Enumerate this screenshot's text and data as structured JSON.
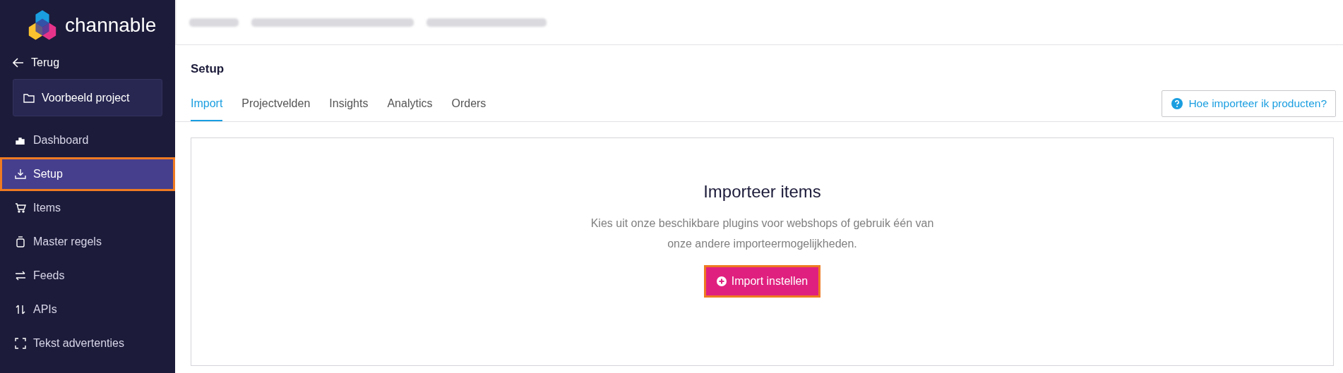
{
  "sidebar": {
    "logo_text": "channable",
    "back_label": "Terug",
    "project": "Voorbeeld project",
    "items": [
      {
        "label": "Dashboard",
        "kind": "chart",
        "selected": false,
        "highlighted": false
      },
      {
        "label": "Setup",
        "kind": "download",
        "selected": true,
        "highlighted": true
      },
      {
        "label": "Items",
        "kind": "cart",
        "selected": false,
        "highlighted": false
      },
      {
        "label": "Master regels",
        "kind": "jar",
        "selected": false,
        "highlighted": false
      },
      {
        "label": "Feeds",
        "kind": "arrows",
        "selected": false,
        "highlighted": false
      },
      {
        "label": "APIs",
        "kind": "updown",
        "selected": false,
        "highlighted": false
      },
      {
        "label": "Tekst advertenties",
        "kind": "frame",
        "selected": false,
        "highlighted": false
      }
    ]
  },
  "page": {
    "title": "Setup",
    "tabs": [
      {
        "label": "Import",
        "selected": true
      },
      {
        "label": "Projectvelden",
        "selected": false
      },
      {
        "label": "Insights",
        "selected": false
      },
      {
        "label": "Analytics",
        "selected": false
      },
      {
        "label": "Orders",
        "selected": false
      }
    ],
    "help_button": "Hoe importeer ik producten?",
    "card": {
      "heading": "Importeer items",
      "text": "Kies uit onze beschikbare plugins voor webshops of gebruik één van onze andere importeermogelijkheden.",
      "button": {
        "label": "Import instellen",
        "highlighted": true
      }
    }
  }
}
